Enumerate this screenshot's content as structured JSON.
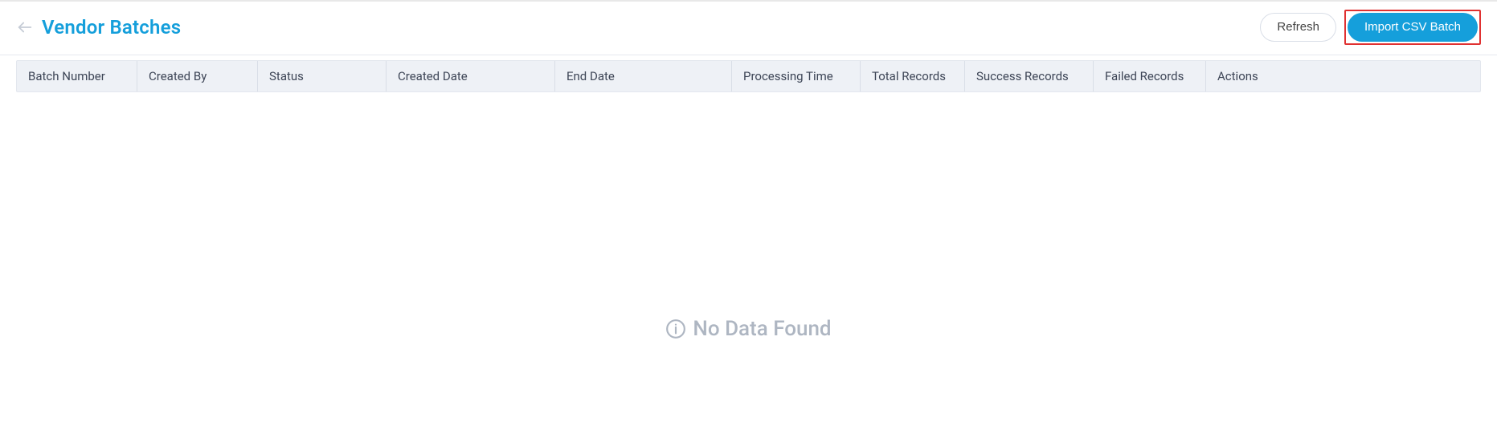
{
  "header": {
    "page_title": "Vendor Batches",
    "refresh_label": "Refresh",
    "import_csv_label": "Import CSV Batch"
  },
  "table": {
    "columns": {
      "batch_number": "Batch Number",
      "created_by": "Created By",
      "status": "Status",
      "created_date": "Created Date",
      "end_date": "End Date",
      "processing_time": "Processing Time",
      "total_records": "Total Records",
      "success_records": "Success Records",
      "failed_records": "Failed Records",
      "actions": "Actions"
    },
    "rows": []
  },
  "empty_state": {
    "message": "No Data Found"
  },
  "colors": {
    "accent": "#159fdb",
    "highlight_border": "#e03131",
    "header_bg": "#eef1f6",
    "muted_text": "#aeb6c2"
  }
}
